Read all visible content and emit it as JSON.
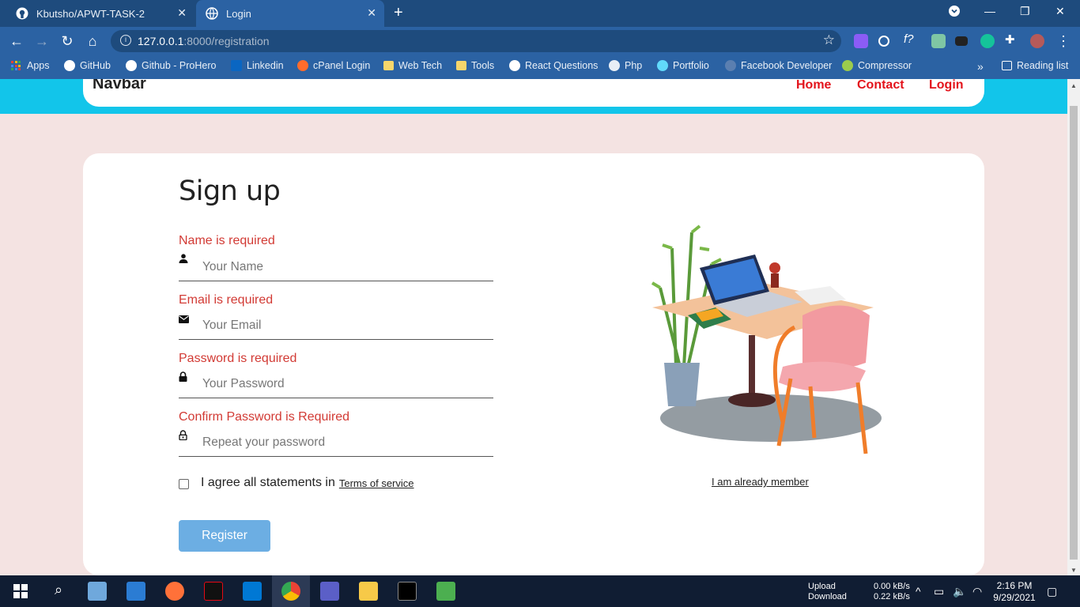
{
  "browser": {
    "tabs": [
      {
        "title": "Kbutsho/APWT-TASK-2",
        "active": false
      },
      {
        "title": "Login",
        "active": true
      }
    ],
    "url_host": "127.0.0.1",
    "url_rest": ":8000/registration",
    "bookmarks": [
      "Apps",
      "GitHub",
      "Github - ProHero",
      "Linkedin",
      "cPanel Login",
      "Web Tech",
      "Tools",
      "React Questions",
      "Php",
      "Portfolio",
      "Facebook Developer",
      "Compressor"
    ],
    "reading_list": "Reading list",
    "overflow": "»"
  },
  "navbar": {
    "brand": "Navbar",
    "links": [
      "Home",
      "Contact",
      "Login"
    ]
  },
  "form": {
    "title": "Sign up",
    "fields": [
      {
        "error": "Name is required",
        "placeholder": "Your Name",
        "icon": "person-icon"
      },
      {
        "error": "Email is required",
        "placeholder": "Your Email",
        "icon": "envelope-icon"
      },
      {
        "error": "Password is required",
        "placeholder": "Your Password",
        "icon": "lock-icon"
      },
      {
        "error": "Confirm Password is Required",
        "placeholder": "Repeat your password",
        "icon": "lock-open-icon"
      }
    ],
    "agree_text": "I agree all statements in",
    "tos_link": "Terms of service",
    "register_label": "Register",
    "already_member": "I am already member"
  },
  "taskbar": {
    "network_labels": [
      "Upload",
      "Download"
    ],
    "network_values": [
      "0.00 kB/s",
      "0.22 kB/s"
    ],
    "time": "2:16 PM",
    "date": "9/29/2021"
  },
  "colors": {
    "accent_cyan": "#12c5ea",
    "error_red": "#d23a34",
    "nav_link_red": "#e3131b",
    "button_blue": "#6caee3",
    "page_bg": "#f4e3e2"
  }
}
